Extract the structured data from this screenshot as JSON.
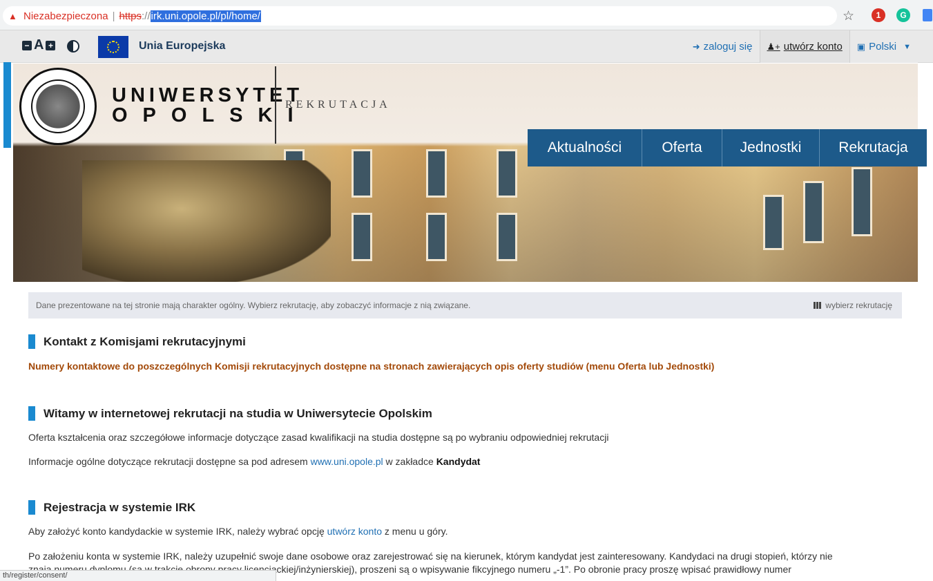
{
  "browser": {
    "security_label": "Niezabezpieczona",
    "url_scheme": "https",
    "url_slashes": "://",
    "url_rest": "irk.uni.opole.pl/pl/home/",
    "status_url": "th/register/consent/",
    "ext_badge": "1"
  },
  "topbar": {
    "a11y_letter": "A",
    "eu_label": "Unia Europejska",
    "login_label": "zaloguj się",
    "create_account_label": "utwórz konto",
    "language_label": "Polski"
  },
  "header": {
    "uni_line1": "UNIWERSYTET",
    "uni_line2": "OPOLSKI",
    "logo_subtitle": "REKRUTACJA"
  },
  "nav": {
    "items": [
      {
        "label": "Aktualności"
      },
      {
        "label": "Oferta"
      },
      {
        "label": "Jednostki"
      },
      {
        "label": "Rekrutacja"
      }
    ]
  },
  "info": {
    "text": "Dane prezentowane na tej stronie mają charakter ogólny. Wybierz rekrutację, aby zobaczyć informacje z nią związane.",
    "choose_label": "wybierz rekrutację"
  },
  "sections": {
    "contact": {
      "title": "Kontakt z Komisjami rekrutacyjnymi",
      "text": "Numery kontaktowe do poszczególnych Komisji rekrutacyjnych dostępne na stronach zawierających opis oferty studiów (menu Oferta lub Jednostki)"
    },
    "welcome": {
      "title": "Witamy w internetowej rekrutacji na studia w Uniwersytecie Opolskim",
      "p1": "Oferta kształcenia oraz szczegółowe informacje dotyczące zasad kwalifikacji na studia dostępne są po wybraniu odpowiedniej rekrutacji",
      "p2_before": "Informacje ogólne dotyczące rekrutacji dostępne sa pod adresem",
      "p2_link": "www.uni.opole.pl",
      "p2_middle": "w zakładce",
      "p2_bold": "Kandydat"
    },
    "register": {
      "title": "Rejestracja w systemie IRK",
      "p1_before": "Aby założyć konto kandydackie w systemie IRK, należy wybrać opcję",
      "p1_link": "utwórz konto",
      "p1_after": "z menu u góry.",
      "p2_line1": "Po założeniu konta w systemie IRK, należy uzupełnić swoje dane osobowe oraz zarejestrować się na kierunek, którym kandydat jest zainteresowany. Kandydaci na drugi stopień, którzy nie",
      "p2_line2": "znają numeru dyplomu (są w trakcie obrony pracy licencjackiej/inżynierskiej), proszeni są o wpisywanie fikcyjnego numeru  „-1”. Po obronie pracy proszę wpisać prawidłowy numer"
    }
  }
}
